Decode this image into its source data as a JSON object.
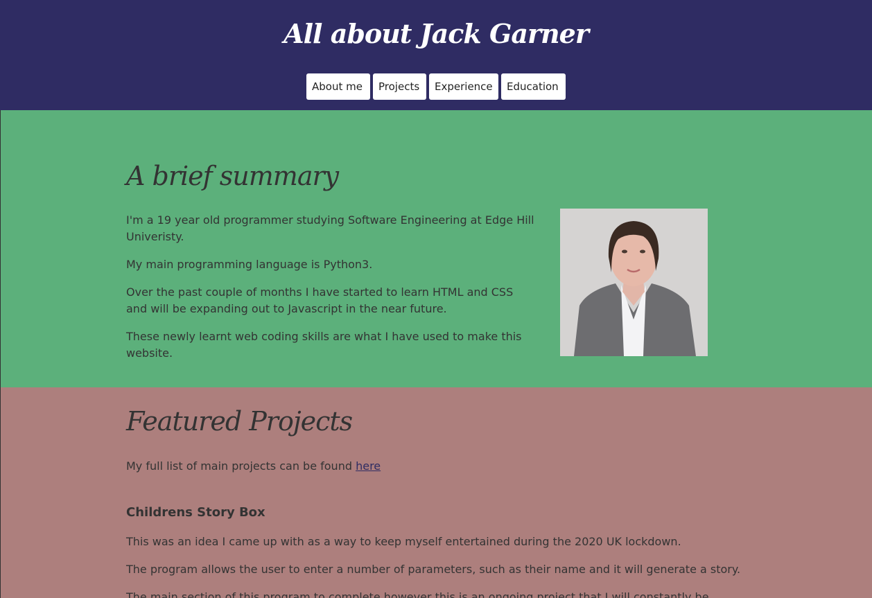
{
  "header": {
    "title": "All about Jack Garner",
    "nav": [
      {
        "label": "About me"
      },
      {
        "label": "Projects"
      },
      {
        "label": "Experience"
      },
      {
        "label": "Education"
      }
    ]
  },
  "summary": {
    "heading": "A brief summary",
    "paragraphs": [
      "I'm a 19 year old programmer studying Software Engineering at Edge Hill Univeristy.",
      "My main programming language is Python3.",
      "Over the past couple of months I have started to learn HTML and CSS and will be expanding out to Javascript in the near future.",
      "These newly learnt web coding skills are what I have used to make this website."
    ]
  },
  "projects": {
    "heading": "Featured Projects",
    "intro_text": "My full list of main projects can be found ",
    "intro_link": "here",
    "project": {
      "title": "Childrens Story Box",
      "paragraphs": [
        "This was an idea I came up with as a way to keep myself entertained during the 2020 UK lockdown.",
        "The program allows the user to enter a number of parameters, such as their name and it will generate a story.",
        "The main section of this program to complete however this is an ongoing project that I will constantly be"
      ]
    }
  },
  "colors": {
    "header_bg": "#2f2c63",
    "summary_bg": "#5cb07b",
    "projects_bg": "#ad7f7d",
    "text": "#333333"
  }
}
